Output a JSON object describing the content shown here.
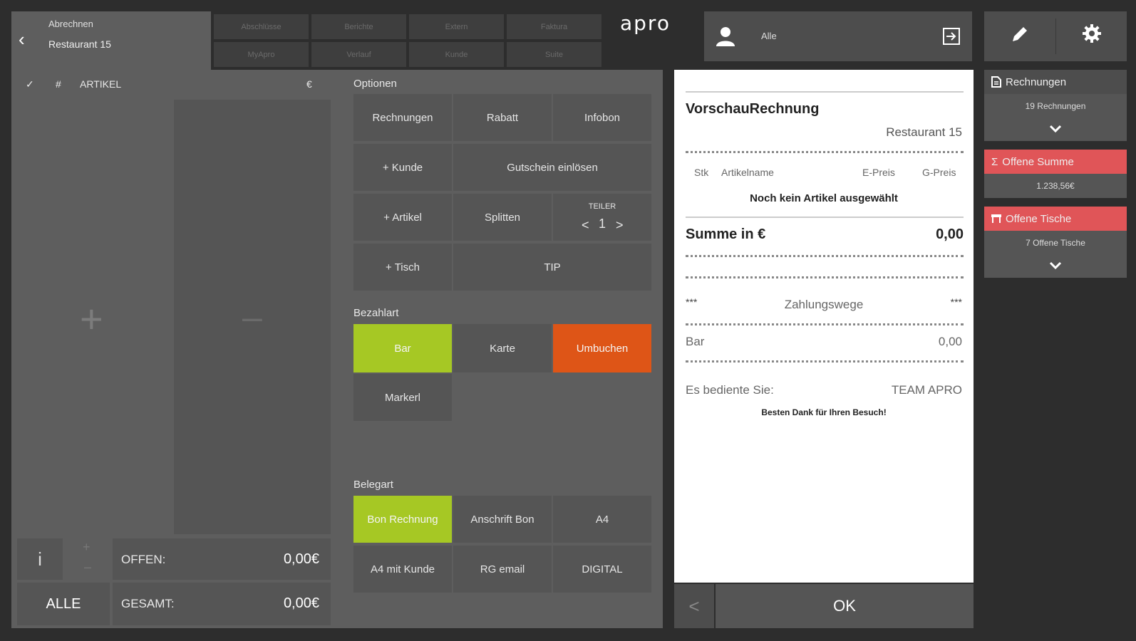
{
  "header": {
    "back_title": "Abrechnen",
    "back_subtitle": "Restaurant 15",
    "nav": [
      "Abschlüsse",
      "Berichte",
      "Extern",
      "Faktura",
      "MyApro",
      "Verlauf",
      "Kunde",
      "Suite"
    ],
    "logo": "apro",
    "user_filter": "Alle"
  },
  "articles": {
    "check_icon": "✓",
    "hash": "#",
    "title": "ARTIKEL",
    "currency": "€",
    "plus": "+",
    "minus": "–"
  },
  "totals": {
    "info": "i",
    "small_plus": "+",
    "small_minus": "–",
    "offen_label": "OFFEN:",
    "offen_value": "0,00€",
    "alle_label": "ALLE",
    "gesamt_label": "GESAMT:",
    "gesamt_value": "0,00€"
  },
  "optionen": {
    "title": "Optionen",
    "rechnungen": "Rechnungen",
    "rabatt": "Rabatt",
    "infobon": "Infobon",
    "kunde": "+ Kunde",
    "gutschein": "Gutschein einlösen",
    "artikel": "+ Artikel",
    "splitten": "Splitten",
    "teiler_label": "TEILER",
    "teiler_left": "<",
    "teiler_value": "1",
    "teiler_right": ">",
    "tisch": "+ Tisch",
    "tip": "TIP"
  },
  "bezahlart": {
    "title": "Bezahlart",
    "bar": "Bar",
    "karte": "Karte",
    "umbuchen": "Umbuchen",
    "markerl": "Markerl"
  },
  "belegart": {
    "title": "Belegart",
    "bon_rechnung": "Bon Rechnung",
    "anschrift_bon": "Anschrift Bon",
    "a4": "A4",
    "a4_kunde": "A4 mit Kunde",
    "rg_email": "RG email",
    "digital": "DIGITAL"
  },
  "receipt": {
    "title": "VorschauRechnung",
    "restaurant": "Restaurant 15",
    "col_stk": "Stk",
    "col_name": "Artikelname",
    "col_epreis": "E-Preis",
    "col_gpreis": "G-Preis",
    "empty": "Noch kein Artikel ausgewählt",
    "summe_label": "Summe in €",
    "summe_value": "0,00",
    "zw_left": "***",
    "zw_title": "Zahlungswege",
    "zw_right": "***",
    "bar_label": "Bar",
    "bar_value": "0,00",
    "served_label": "Es bediente Sie:",
    "served_value": "TEAM APRO",
    "thanks": "Besten Dank für Ihren Besuch!",
    "back": "<",
    "ok": "OK"
  },
  "sidebar": {
    "rechnungen_title": "Rechnungen",
    "rechnungen_count": "19 Rechnungen",
    "summe_title": "Offene Summe",
    "summe_value": "1.238,56€",
    "tische_title": "Offene Tische",
    "tische_count": "7 Offene Tische",
    "sigma": "Σ"
  },
  "colors": {
    "green": "#a6c824",
    "orange": "#de5517",
    "red": "#e05558"
  },
  "icons": [
    "chevron-left-icon",
    "user-icon",
    "logout-icon",
    "pencil-icon",
    "gear-icon",
    "check-icon",
    "document-icon",
    "table-icon",
    "chevron-down-icon"
  ]
}
